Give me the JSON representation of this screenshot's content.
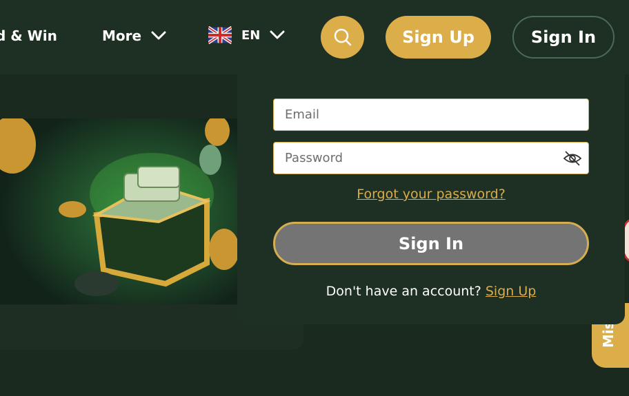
{
  "header": {
    "nav_partial": "d & Win",
    "more_label": "More",
    "language_code": "EN",
    "signup_label": "Sign Up",
    "signin_label": "Sign In"
  },
  "form": {
    "email_placeholder": "Email",
    "password_placeholder": "Password",
    "forgot_label": "Forgot your password?",
    "submit_label": "Sign In",
    "no_account_text": "Don't have an account?",
    "signup_link": "Sign Up"
  },
  "side_tab": {
    "label": "Mis"
  },
  "colors": {
    "accent": "#dcae4a",
    "background": "#1b2a1f",
    "panel": "#1e2f23",
    "disabled_button": "#747474"
  },
  "icons": [
    "chevron-down-icon",
    "uk-flag-icon",
    "search-icon",
    "eye-off-icon"
  ]
}
